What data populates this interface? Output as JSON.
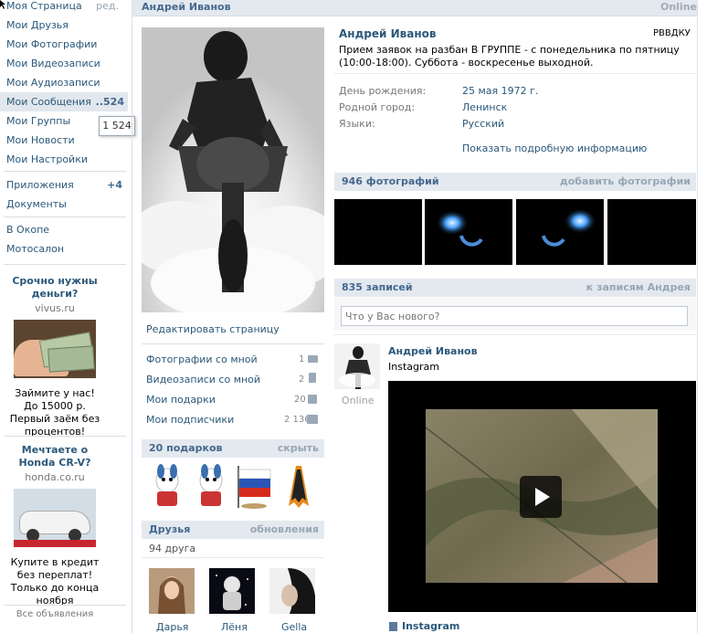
{
  "left_menu": {
    "items": [
      {
        "label": "Моя Страница",
        "extra": "ред."
      },
      {
        "label": "Мои Друзья"
      },
      {
        "label": "Мои Фотографии"
      },
      {
        "label": "Мои Видеозаписи"
      },
      {
        "label": "Мои Аудиозаписи"
      },
      {
        "label": "Мои Сообщения",
        "extra": "..524"
      },
      {
        "label": "Мои Группы"
      },
      {
        "label": "Мои Новости"
      },
      {
        "label": "Мои Настройки"
      }
    ],
    "items2": [
      {
        "label": "Приложения",
        "extra": "+4"
      },
      {
        "label": "Документы"
      }
    ],
    "items3": [
      {
        "label": "В Окопе"
      },
      {
        "label": "Мотосалон"
      }
    ],
    "tooltip": "1 524"
  },
  "ads": [
    {
      "title": "Срочно нужны деньги?",
      "domain": "vivus.ru",
      "text": "Займите у нас! До 15000 р. Первый заём без процентов!"
    },
    {
      "title": "Мечтаете о Honda CR-V?",
      "domain": "honda.co.ru",
      "text": "Купите в кредит без переплат! Только до конца ноября"
    }
  ],
  "ads_all": "Все объявления",
  "header": {
    "name": "Андрей Иванов",
    "status": "Online"
  },
  "profile": {
    "name": "Андрей Иванов",
    "tag": "РВВДКУ",
    "status": "Прием заявок на разбан В ГРУППЕ - с понедельника по пятницу (10:00-18:00). Суббота - воскресенье выходной.",
    "fields": [
      {
        "label": "День рождения:",
        "value": "25 мая 1972 г."
      },
      {
        "label": "Родной город:",
        "value": "Ленинск"
      },
      {
        "label": "Языки:",
        "value": "Русский"
      }
    ],
    "show_more": "Показать подробную информацию"
  },
  "middle": {
    "edit": "Редактировать страницу",
    "links": [
      {
        "label": "Фотографии со мной",
        "count": "1",
        "icon": "camera-icon"
      },
      {
        "label": "Видеозаписи со мной",
        "count": "2",
        "icon": "film-icon"
      },
      {
        "label": "Мои подарки",
        "count": "20",
        "icon": "gift-icon"
      },
      {
        "label": "Мои подписчики",
        "count": "2 136",
        "icon": "people-icon"
      }
    ],
    "gifts_title": "20 подарков",
    "gifts_hide": "скрыть",
    "friends_title": "Друзья",
    "friends_updates": "обновления",
    "friends_count": "94 друга",
    "friends": [
      {
        "name": "Дарья"
      },
      {
        "name": "Лёня"
      },
      {
        "name": "Gella"
      }
    ]
  },
  "photos": {
    "title": "946 фотографий",
    "add": "добавить фотографии"
  },
  "wall": {
    "title": "835 записей",
    "to_wall": "к записям Андрея",
    "placeholder": "Что у Вас нового?",
    "post_author": "Андрей Иванов",
    "post_text": "Instagram",
    "author_status": "Online",
    "attachment": "Instagram"
  },
  "colors": {
    "link": "#2B587A",
    "bar": "#e3e9ef",
    "accent": "#45688E"
  }
}
